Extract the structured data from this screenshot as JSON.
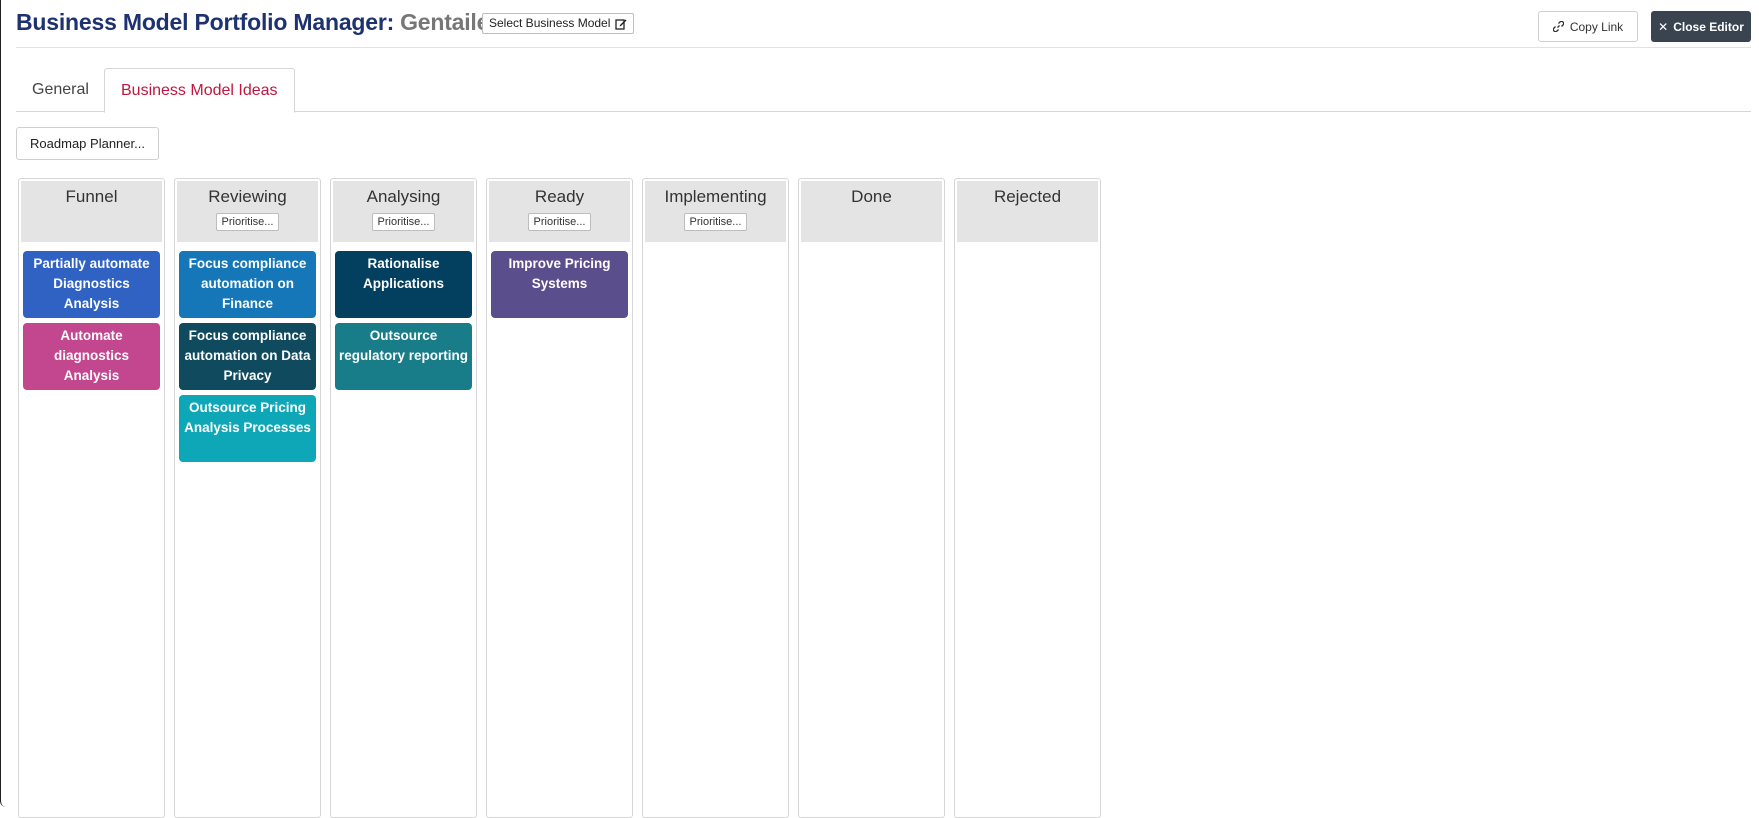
{
  "header": {
    "title": "Business Model Portfolio Manager:",
    "entity": "Gentailer",
    "select_label": "Select Business Model",
    "copy_link": "Copy Link",
    "close_editor": "Close Editor"
  },
  "tabs": [
    {
      "label": "General"
    },
    {
      "label": "Business Model Ideas"
    }
  ],
  "roadmap_label": "Roadmap Planner...",
  "prioritise_label": "Prioritise...",
  "colors": {
    "title": "#1e3270",
    "active_tab": "#c0163e",
    "close_button": "#3a4451"
  },
  "columns": [
    {
      "title": "Funnel",
      "cards": [
        {
          "label": "Partially automate Diagnostics Analysis",
          "color": "#3062c4"
        },
        {
          "label": "Automate diagnostics Analysis",
          "color": "#c2478f"
        }
      ]
    },
    {
      "title": "Reviewing",
      "cards": [
        {
          "label": "Focus compliance automation on Finance",
          "color": "#1576b8"
        },
        {
          "label": "Focus compliance automation on Data Privacy",
          "color": "#0f4a5e"
        },
        {
          "label": "Outsource Pricing Analysis Processes",
          "color": "#0ea7b7"
        }
      ]
    },
    {
      "title": "Analysing",
      "cards": [
        {
          "label": "Rationalise Applications",
          "color": "#033f5f"
        },
        {
          "label": "Outsource regulatory reporting",
          "color": "#187d88"
        }
      ]
    },
    {
      "title": "Ready",
      "cards": [
        {
          "label": "Improve Pricing Systems",
          "color": "#5a4e8d"
        }
      ]
    },
    {
      "title": "Implementing",
      "cards": []
    },
    {
      "title": "Done",
      "cards": []
    },
    {
      "title": "Rejected",
      "cards": []
    }
  ]
}
